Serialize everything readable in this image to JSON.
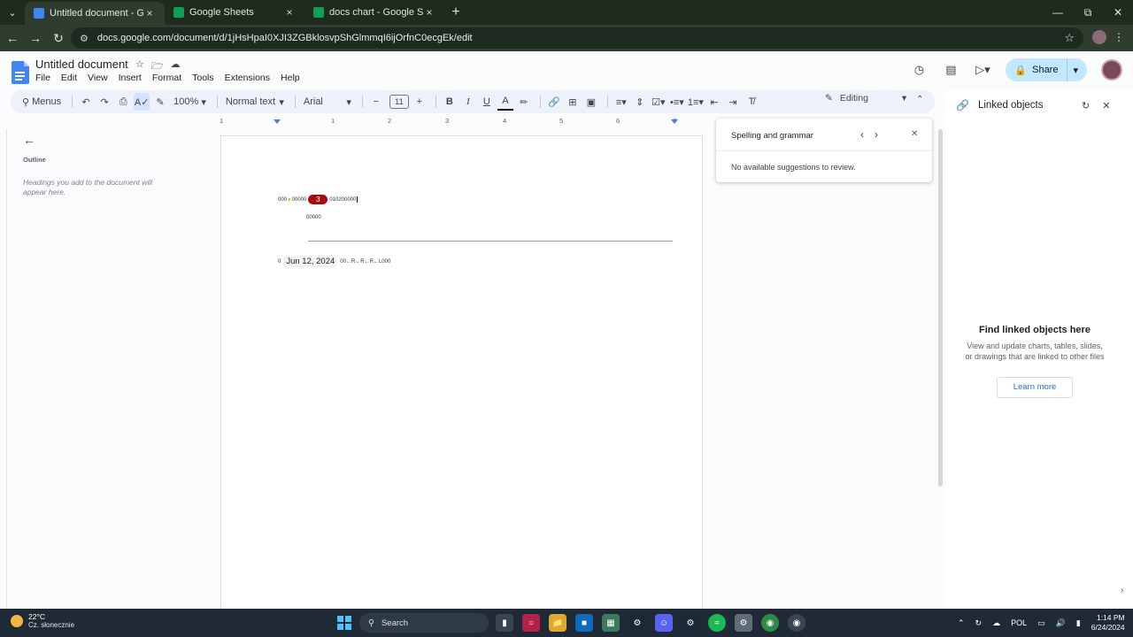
{
  "browser": {
    "tabs": [
      {
        "title": "Untitled document - Google Docs",
        "icon": "docs-icon",
        "active": true
      },
      {
        "title": "Google Sheets",
        "icon": "sheets-icon",
        "active": false
      },
      {
        "title": "docs chart - Google Sheets",
        "icon": "sheets-icon",
        "active": false
      }
    ],
    "url": "docs.google.com/document/d/1jHsHpaI0XJI3ZGBklosvpShGlmmqI6ijOrfnC0ecgEk/edit"
  },
  "docs": {
    "title": "Untitled document",
    "menu": [
      "File",
      "Edit",
      "View",
      "Insert",
      "Format",
      "Tools",
      "Extensions",
      "Help"
    ],
    "share_label": "Share",
    "toolbar": {
      "menus_label": "Menus",
      "zoom": "100%",
      "style": "Normal text",
      "font": "Arial",
      "font_size": "11",
      "mode": "Editing"
    },
    "ruler_ticks": [
      "1",
      "1",
      "2",
      "3",
      "4",
      "5",
      "6",
      "7"
    ],
    "outline": {
      "label": "Outline",
      "hint": "Headings you add to the document will appear here."
    },
    "page": {
      "line1_prefix": "000",
      "line1_mid": "00000",
      "line1_count": "3",
      "line1_suffix": "010200000",
      "line2": "00000",
      "line3_prefix": "0",
      "date_chip": "Jun 12, 2024",
      "line3_suffix": "00←R←R←R←L000"
    },
    "spelling": {
      "title": "Spelling and grammar",
      "message": "No available suggestions to review."
    },
    "linked_objects": {
      "title": "Linked objects",
      "empty_title": "Find linked objects here",
      "empty_desc": "View and update charts, tables, slides, or drawings that are linked to other files",
      "learn_more": "Learn more"
    }
  },
  "taskbar": {
    "temperature": "22°C",
    "condition": "Cz. słonecznie",
    "search_label": "Search",
    "language": "POL",
    "time": "1:14 PM",
    "date": "6/24/2024"
  },
  "colors": {
    "accent": "#1a73e8",
    "share_bg": "#c2e7ff",
    "chip_red": "#a50e0e",
    "taskbar_bg": "#202a36"
  }
}
